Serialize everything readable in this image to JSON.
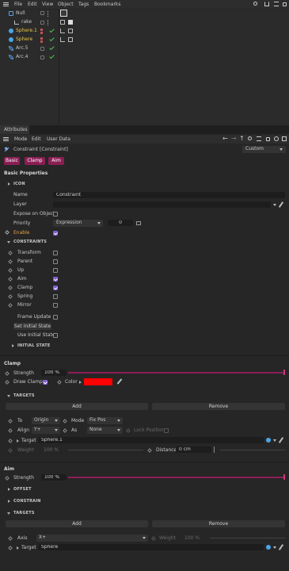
{
  "menubar": {
    "items": [
      "File",
      "Edit",
      "View",
      "Object",
      "Tags",
      "Bookmarks"
    ]
  },
  "objects": [
    {
      "name": "Null",
      "indent": 0,
      "icon": "null-icon",
      "color": "#c8c8c8"
    },
    {
      "name": "rake",
      "indent": 1,
      "icon": "rake-icon",
      "color": "#c8c8c8"
    },
    {
      "name": "Sphere.1",
      "indent": 1,
      "icon": "sphere-icon",
      "color": "#e8c84a"
    },
    {
      "name": "Sphere",
      "indent": 1,
      "icon": "sphere-icon",
      "color": "#e8c84a"
    },
    {
      "name": "Arc.5",
      "indent": 1,
      "icon": "spline-icon",
      "color": "#c8c8c8"
    },
    {
      "name": "Arc.4",
      "indent": 1,
      "icon": "spline-icon",
      "color": "#c8c8c8"
    }
  ],
  "attributes_tab": "Attributes",
  "attr_menu": [
    "Mode",
    "Edit",
    "User Data"
  ],
  "object_title": "Constraint [Constraint]",
  "preset": "Custom",
  "tabs": [
    "Basic",
    "Clamp",
    "Aim"
  ],
  "basic": {
    "heading": "Basic Properties",
    "icon_label": "ICON",
    "name_label": "Name",
    "name_value": "Constraint",
    "layer_label": "Layer",
    "expose_label": "Expose on Object",
    "priority_label": "Priority",
    "priority_value": "Expression",
    "priority_num": "0",
    "enable_label": "Enable",
    "constraints_label": "CONSTRAINTS",
    "constraints": [
      {
        "label": "Transform",
        "checked": false
      },
      {
        "label": "Parent",
        "checked": false
      },
      {
        "label": "Up",
        "checked": false
      },
      {
        "label": "Aim",
        "checked": true
      },
      {
        "label": "Clamp",
        "checked": true
      },
      {
        "label": "Spring",
        "checked": false
      },
      {
        "label": "Mirror",
        "checked": false
      }
    ],
    "frame_update_label": "Frame Update",
    "set_initial_label": "Set Initial State",
    "use_initial_label": "Use Initial State",
    "initial_state_label": "INITIAL STATE"
  },
  "clamp": {
    "heading": "Clamp",
    "strength_label": "Strength",
    "strength_value": "100 %",
    "strength_fraction": 1.0,
    "draw_clamp_label": "Draw Clamp",
    "color_label": "Color",
    "color_value": "#ff0000",
    "targets_label": "TARGETS",
    "add_label": "Add",
    "remove_label": "Remove",
    "to_label": "To",
    "to_value": "Origin",
    "mode_label": "Mode",
    "mode_value": "Fix Pos",
    "align_label": "Align",
    "align_value": "Y+",
    "as_label": "As",
    "as_value": "None",
    "lock_label": "Lock Position",
    "target_label": "Target",
    "target_value": "Sphere.1",
    "weight_label": "Weight",
    "weight_value": "100 %",
    "distance_label": "Distance",
    "distance_value": "0 cm"
  },
  "aim": {
    "heading": "Aim",
    "strength_label": "Strength",
    "strength_value": "100 %",
    "strength_fraction": 1.0,
    "offset_label": "OFFSET",
    "constrain_label": "CONSTRAIN",
    "targets_label": "TARGETS",
    "add_label": "Add",
    "remove_label": "Remove",
    "axis_label": "Axis",
    "axis_value": "X+",
    "weight_label": "Weight",
    "weight_value": "100 %",
    "target_label": "Target",
    "target_value": "Sphere"
  }
}
